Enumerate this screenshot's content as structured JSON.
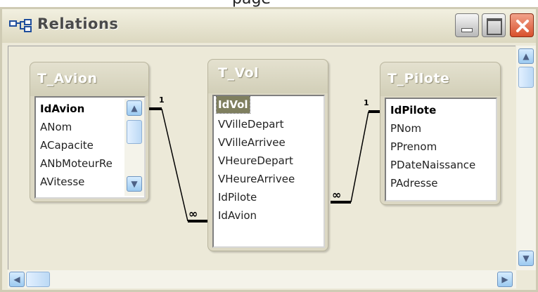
{
  "top_strip_text": "page",
  "window": {
    "title": "Relations",
    "controls": {
      "minimize": "minimize",
      "maximize": "maximize",
      "close": "close"
    }
  },
  "tables": {
    "avion": {
      "name": "T_Avion",
      "fields": [
        "IdAvion",
        "ANom",
        "ACapacite",
        "ANbMoteurRe",
        "AVitesse"
      ],
      "key_field": "IdAvion"
    },
    "vol": {
      "name": "T_Vol",
      "fields": [
        "IdVol",
        "VVilleDepart",
        "VVilleArrivee",
        "VHeureDepart",
        "VHeureArrivee",
        "IdPilote",
        "IdAvion"
      ],
      "key_field": "IdVol",
      "selected_field": "IdVol"
    },
    "pilote": {
      "name": "T_Pilote",
      "fields": [
        "IdPilote",
        "PNom",
        "PPrenom",
        "PDateNaissance",
        "PAdresse"
      ],
      "key_field": "IdPilote"
    }
  },
  "relationships": [
    {
      "from": "T_Avion.IdAvion",
      "to": "T_Vol.IdAvion",
      "one_label": "1",
      "many_label": "∞"
    },
    {
      "from": "T_Pilote.IdPilote",
      "to": "T_Vol.IdPilote",
      "one_label": "1",
      "many_label": "∞"
    }
  ],
  "icons": {
    "relations_icon": "relations-icon",
    "scroll_up": "scroll-up-arrow-icon",
    "scroll_down": "scroll-down-arrow-icon",
    "scroll_left": "scroll-left-arrow-icon",
    "scroll_right": "scroll-right-arrow-icon"
  },
  "colors": {
    "title_text": "#4a4a4a",
    "close_button": "#d8502c",
    "selected_field_bg": "#7f7f5f",
    "table_header_text": "#ffffff",
    "scroll_button": "#9ccaf0"
  }
}
